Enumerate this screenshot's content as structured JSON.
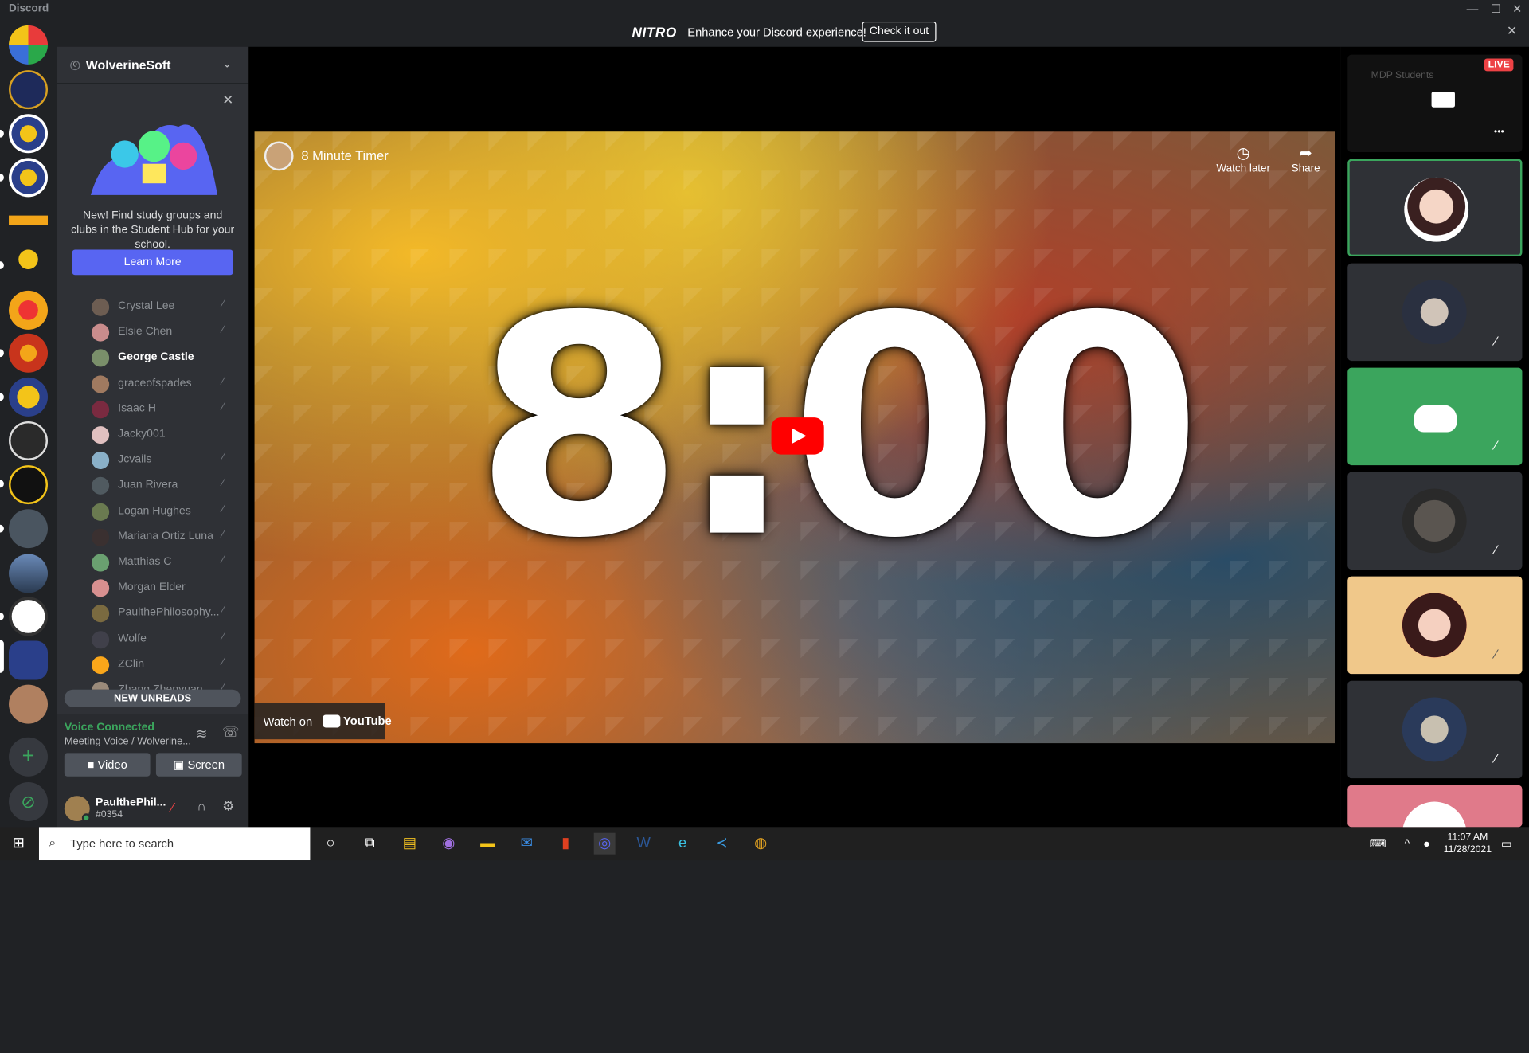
{
  "window": {
    "title": "Discord",
    "min": "—",
    "max": "☐",
    "close": "✕"
  },
  "banner": {
    "logo": "NITRO",
    "message": "Enhance your Discord experience!",
    "cta": "Check it out",
    "close": "✕"
  },
  "server": {
    "name": "WolverineSoft",
    "boost": "0",
    "chevron": "⌄"
  },
  "promo": {
    "close": "✕",
    "text": "New! Find study groups and clubs in the Student Hub for your school.",
    "button": "Learn More"
  },
  "members": [
    {
      "name": "Crystal Lee",
      "muted": true,
      "color": "#6d5d52"
    },
    {
      "name": "Elsie Chen",
      "muted": true,
      "color": "#c98c8c"
    },
    {
      "name": "George Castle",
      "muted": false,
      "color": "#7a8f6a",
      "active": true
    },
    {
      "name": "graceofspades",
      "muted": true,
      "color": "#a07a60"
    },
    {
      "name": "Isaac H",
      "muted": true,
      "color": "#7a2a40"
    },
    {
      "name": "Jacky001",
      "muted": false,
      "color": "#e0c0c0"
    },
    {
      "name": "Jcvails",
      "muted": true,
      "color": "#8ab0c8"
    },
    {
      "name": "Juan Rivera",
      "muted": true,
      "color": "#505a60"
    },
    {
      "name": "Logan Hughes",
      "muted": true,
      "color": "#6a7a50"
    },
    {
      "name": "Mariana Ortiz Luna",
      "muted": true,
      "color": "#3a3030"
    },
    {
      "name": "Matthias C",
      "muted": true,
      "color": "#6aa070"
    },
    {
      "name": "Morgan Elder",
      "muted": false,
      "color": "#d89090"
    },
    {
      "name": "PaulthePhilosophy...",
      "muted": true,
      "color": "#7a6a40"
    },
    {
      "name": "Wolfe",
      "muted": true,
      "color": "#40404a"
    },
    {
      "name": "ZClin",
      "muted": true,
      "color": "#faa61a"
    },
    {
      "name": "Zhang Zhenyuan",
      "muted": true,
      "color": "#9a8a7a"
    }
  ],
  "new_unreads": "NEW UNREADS",
  "voice": {
    "status": "Voice Connected",
    "channel": "Meeting Voice / Wolverine...",
    "video": "Video",
    "screen": "Screen"
  },
  "user": {
    "name": "PaulthePhil...",
    "tag": "#0354"
  },
  "video": {
    "title": "8 Minute Timer",
    "timer": "8:00",
    "watch_later": "Watch later",
    "share": "Share",
    "watch_on": "Watch on",
    "youtube": "YouTube"
  },
  "tiles": {
    "live": "LIVE",
    "stream_label": "MDP Students",
    "more": "•••"
  },
  "taskbar": {
    "search_placeholder": "Type here to search",
    "time": "11:07 AM",
    "date": "11/28/2021"
  }
}
